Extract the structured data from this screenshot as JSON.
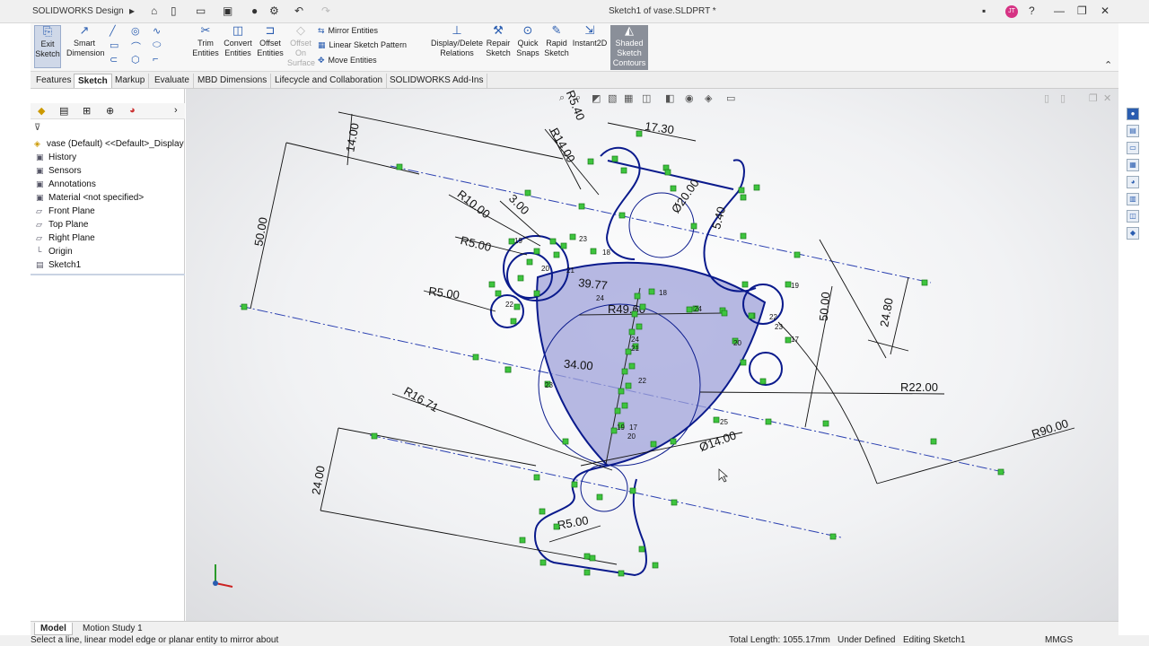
{
  "app": {
    "brand": "SOLIDWORKS",
    "brand_suffix": "Design",
    "doc_title": "Sketch1 of vase.SLDPRT *"
  },
  "title_bar": {
    "user_initials": "JT"
  },
  "ribbon": {
    "exit_sketch": "Exit Sketch",
    "smart_dimension": "Smart Dimension",
    "trim_entities": "Trim Entities",
    "convert_entities": "Convert Entities",
    "offset_entities": "Offset Entities",
    "offset_on_surface": "Offset On Surface",
    "mirror_entities": "Mirror Entities",
    "linear_sketch_pattern": "Linear Sketch Pattern",
    "move_entities": "Move Entities",
    "display_delete_relations": "Display/Delete Relations",
    "repair_sketch": "Repair Sketch",
    "quick_snaps": "Quick Snaps",
    "rapid_sketch": "Rapid Sketch",
    "instant2d": "Instant2D",
    "shaded_sketch_contours": "Shaded Sketch Contours"
  },
  "tabs": [
    "Features",
    "Sketch",
    "Markup",
    "Evaluate",
    "MBD Dimensions",
    "Lifecycle and Collaboration",
    "SOLIDWORKS Add-Ins"
  ],
  "active_tab": "Sketch",
  "tree": {
    "root": "vase (Default) <<Default>_Display",
    "items": [
      "History",
      "Sensors",
      "Annotations",
      "Material <not specified>",
      "Front Plane",
      "Top Plane",
      "Right Plane",
      "Origin",
      "Sketch1"
    ]
  },
  "dimensions": {
    "d_14": "14.00",
    "d_r540": "R5.40",
    "d_1730": "17.30",
    "d_r1400": "R14.00",
    "d_dia2000": "Ø20.00",
    "d_540": "5.40",
    "d_5000_left": "50.00",
    "d_r1000": "R10.00",
    "d_300": "3.00",
    "d_r500_a": "R5.00",
    "d_r500_b": "R5.00",
    "d_3977": "39.77",
    "d_r4960": "R49.60",
    "d_5000_right": "50.00",
    "d_2480": "24.80",
    "d_3400": "34.00",
    "d_r2200": "R22.00",
    "d_r1671": "R16.71",
    "d_dia1400": "Ø14.00",
    "d_r9000": "R90.00",
    "d_2400": "24.00",
    "d_r500_c": "R5.00"
  },
  "relations": [
    "19",
    "23",
    "18",
    "20",
    "21",
    "22",
    "24",
    "18",
    "24",
    "19",
    "22",
    "23",
    "20",
    "17",
    "24",
    "21",
    "23",
    "22",
    "19",
    "17",
    "20",
    "25"
  ],
  "bottom_tabs": [
    "Model",
    "Motion Study 1"
  ],
  "status": {
    "hint": "Select a line, linear model edge or planar entity to mirror about",
    "total_length": "Total Length: 1055.17mm",
    "state": "Under Defined",
    "editing": "Editing Sketch1",
    "units": "MMGS"
  },
  "colors": {
    "accent": "#2a5db0",
    "sketch": "#0a1a8c",
    "shade": "#9fa2da",
    "points": "#3ec43e"
  }
}
